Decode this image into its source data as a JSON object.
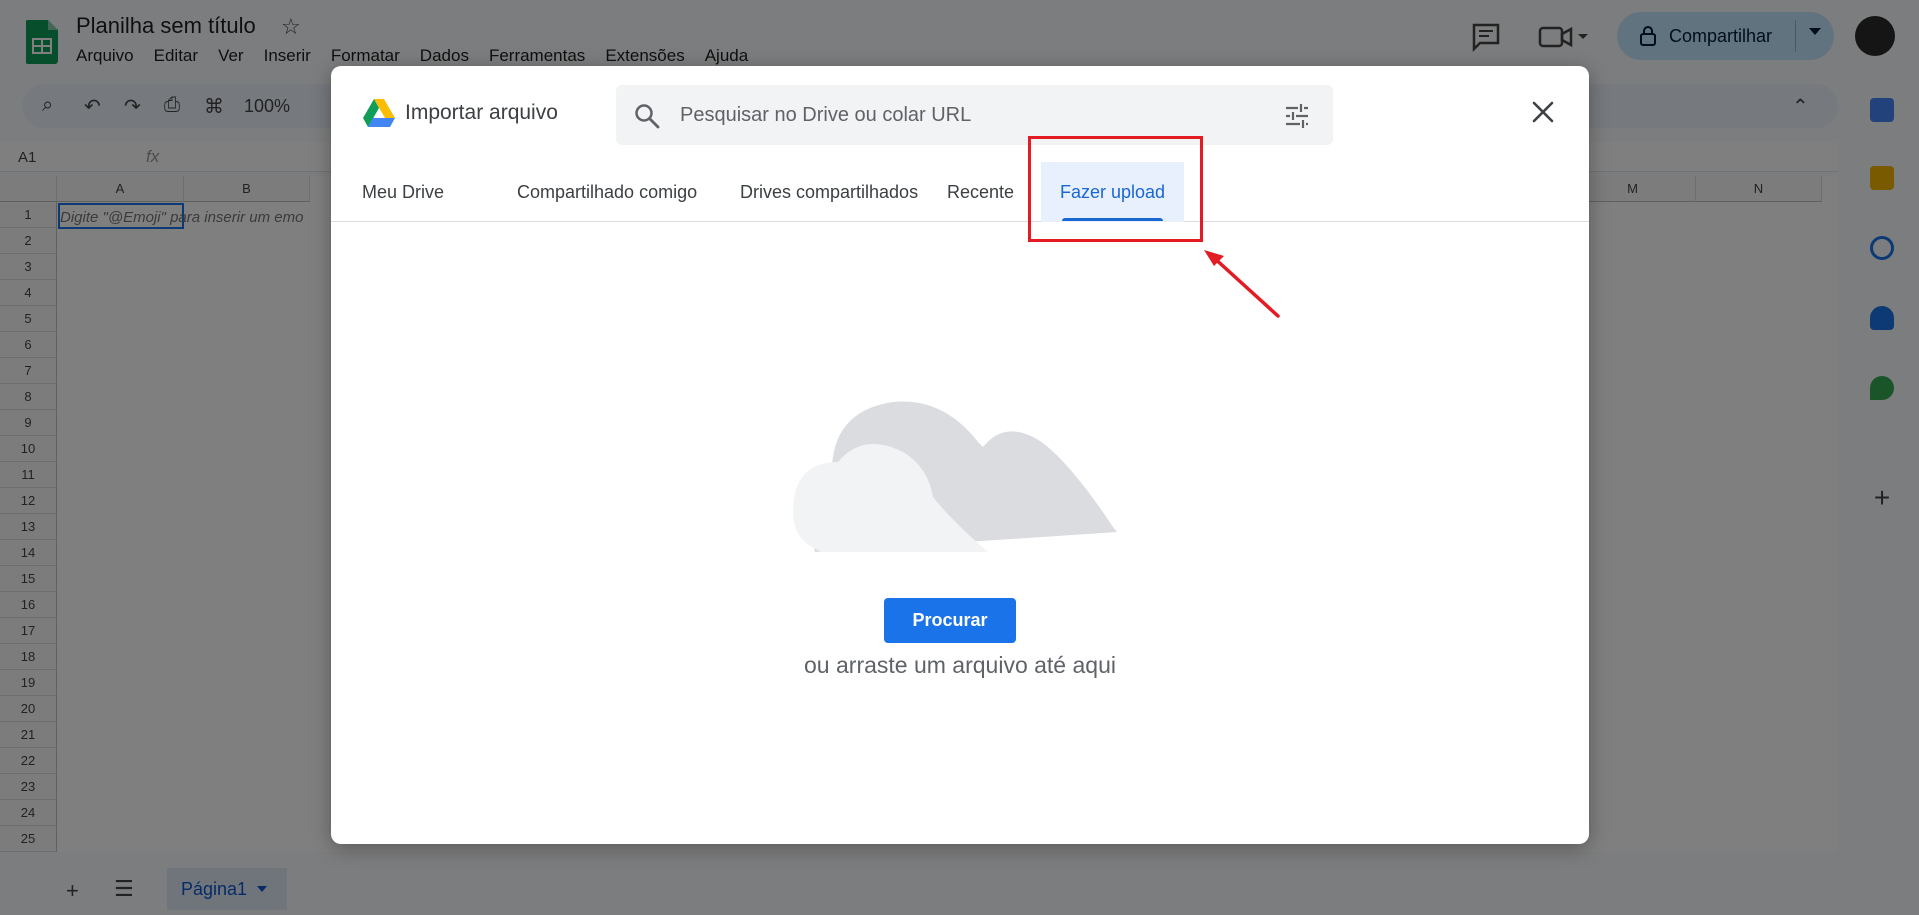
{
  "app": {
    "doc_title": "Planilha sem título",
    "menu": [
      "Arquivo",
      "Editar",
      "Ver",
      "Inserir",
      "Formatar",
      "Dados",
      "Ferramentas",
      "Extensões",
      "Ajuda"
    ],
    "share_label": "Compartilhar",
    "zoom": "100%",
    "name_box": "A1",
    "fx_label": "fx",
    "cell_hint": "Digite \"@Emoji\" para inserir um emo",
    "columns": [
      "A",
      "B",
      "M",
      "N"
    ],
    "rows": [
      "1",
      "2",
      "3",
      "4",
      "5",
      "6",
      "7",
      "8",
      "9",
      "10",
      "11",
      "12",
      "13",
      "14",
      "15",
      "16",
      "17",
      "18",
      "19",
      "20",
      "21",
      "22",
      "23",
      "24",
      "25"
    ],
    "sheet_tab": "Página1"
  },
  "dialog": {
    "title": "Importar arquivo",
    "search_placeholder": "Pesquisar no Drive ou colar URL",
    "tabs": [
      {
        "label": "Meu Drive",
        "active": false
      },
      {
        "label": "Compartilhado comigo",
        "active": false
      },
      {
        "label": "Drives compartilhados",
        "active": false
      },
      {
        "label": "Recente",
        "active": false
      },
      {
        "label": "Fazer upload",
        "active": true
      }
    ],
    "browse_button": "Procurar",
    "drag_hint": "ou arraste um arquivo até aqui"
  },
  "colors": {
    "accent": "#1a73e8",
    "annotation": "#e31b23"
  },
  "icons": {
    "search": "search-icon",
    "filter": "filter-icon",
    "close": "close-icon",
    "drive": "google-drive-icon"
  }
}
